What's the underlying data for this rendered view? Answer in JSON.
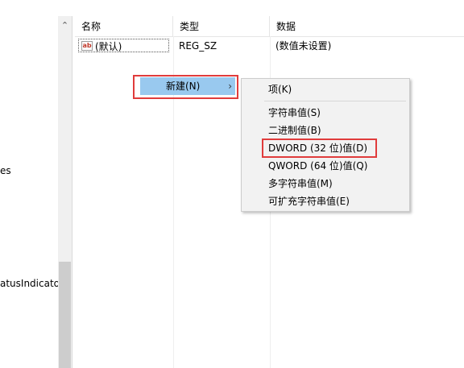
{
  "tree": {
    "items": [
      {
        "label": "es"
      },
      {
        "label": "atusIndicator"
      }
    ]
  },
  "list": {
    "columns": [
      "名称",
      "类型",
      "数据"
    ],
    "rows": [
      {
        "name": "(默认)",
        "type": "REG_SZ",
        "data": "(数值未设置)"
      }
    ]
  },
  "context_menu": {
    "new_item": {
      "label": "新建(N)",
      "arrow": "›"
    }
  },
  "submenu": {
    "items": [
      {
        "label": "项(K)"
      },
      {
        "label": "字符串值(S)"
      },
      {
        "label": "二进制值(B)"
      },
      {
        "label": "DWORD (32 位)值(D)"
      },
      {
        "label": "QWORD (64 位)值(Q)"
      },
      {
        "label": "多字符串值(M)"
      },
      {
        "label": "可扩充字符串值(E)"
      }
    ]
  },
  "icons": {
    "string_value": "ab-icon",
    "scroll_up": "chevron-up-icon"
  },
  "colors": {
    "highlight": "#99c9ef",
    "annotation_red": "#e03c3c",
    "menu_bg": "#f2f2f2"
  }
}
